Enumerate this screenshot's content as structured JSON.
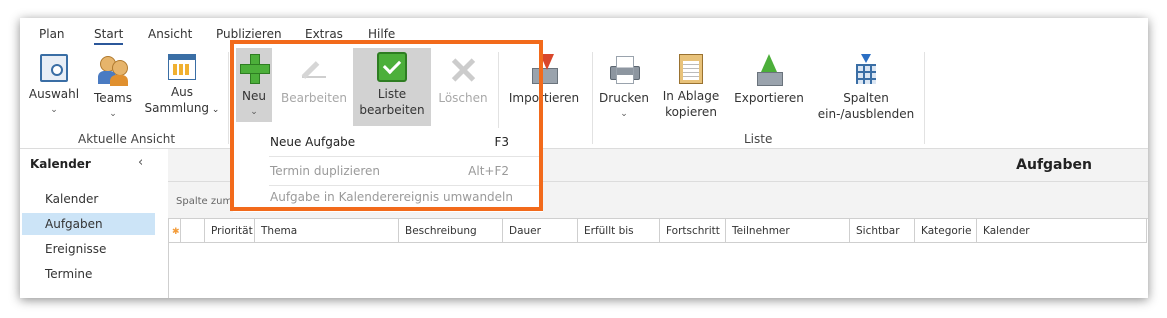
{
  "menu": {
    "tabs": [
      "Plan",
      "Start",
      "Ansicht",
      "Publizieren",
      "Extras",
      "Hilfe"
    ],
    "active": "Start"
  },
  "ribbon": {
    "auswahl": "Auswahl",
    "teams": "Teams",
    "aus_sammlung_1": "Aus",
    "aus_sammlung_2": "Sammlung",
    "neu": "Neu",
    "bearbeiten": "Bearbeiten",
    "liste_bearbeiten_1": "Liste",
    "liste_bearbeiten_2": "bearbeiten",
    "loeschen": "Löschen",
    "importieren": "Importieren",
    "drucken": "Drucken",
    "in_ablage_1": "In Ablage",
    "in_ablage_2": "kopieren",
    "exportieren": "Exportieren",
    "spalten_1": "Spalten",
    "spalten_2": "ein-/ausblenden",
    "group_aktuelle_ansicht": "Aktuelle Ansicht",
    "group_liste": "Liste"
  },
  "dropdown": {
    "items": [
      {
        "label": "Neue Aufgabe",
        "shortcut": "F3",
        "enabled": true
      },
      {
        "label": "Termin duplizieren",
        "shortcut": "Alt+F2",
        "enabled": false
      },
      {
        "label": "Aufgabe in Kalenderereignis umwandeln",
        "shortcut": "",
        "enabled": false
      }
    ]
  },
  "sidenav": {
    "title": "Kalender",
    "items": [
      "Kalender",
      "Aufgaben",
      "Ereignisse",
      "Termine"
    ],
    "selected": "Aufgaben"
  },
  "main": {
    "title": "Aufgaben",
    "group_hint": "Spalte zum Gruppieren hierher ziehen",
    "columns": [
      "Priorität",
      "Thema",
      "Beschreibung",
      "Dauer",
      "Erfüllt bis",
      "Fortschritt",
      "Teilnehmer",
      "Sichtbar",
      "Kategorie",
      "Kalender"
    ]
  },
  "colors": {
    "highlight": "#f26a1b",
    "selection": "#cce4f7",
    "accent": "#2b579a"
  }
}
